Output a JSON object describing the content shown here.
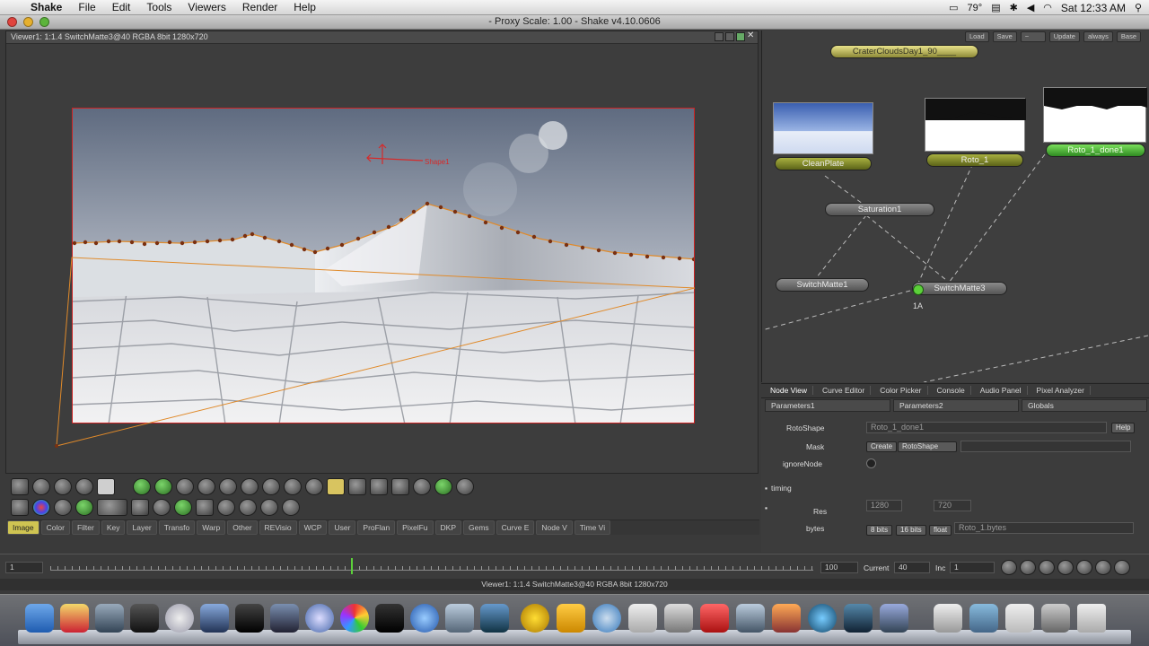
{
  "menubar": {
    "app_name": "Shake",
    "items": [
      "File",
      "Edit",
      "Tools",
      "Viewers",
      "Render",
      "Help"
    ],
    "status": {
      "temp": "79°",
      "clock": "Sat 12:33 AM"
    }
  },
  "window": {
    "title": "- Proxy Scale: 1.00 - Shake v4.10.0606"
  },
  "viewer": {
    "header": "Viewer1: 1:1.4 SwitchMatte3@40 RGBA 8bit 1280x720",
    "shape_label": "Shape1"
  },
  "tool_tabs": [
    "Image",
    "Color",
    "Filter",
    "Key",
    "Layer",
    "Transfo",
    "Warp",
    "Other",
    "REVisio",
    "WCP",
    "User",
    "ProFlan",
    "PixelFu",
    "DKP",
    "Gems",
    "Curve E",
    "Node V",
    "Time Vi"
  ],
  "active_tool_tab": "Image",
  "timeline": {
    "start": "1",
    "end": "100",
    "current_label": "Current",
    "current_value": "40",
    "inc_label": "Inc",
    "inc_value": "1",
    "marker_frame": 40
  },
  "status_line": "Viewer1: 1:1.4 SwitchMatte3@40 RGBA 8bit 1280x720",
  "node_toolbar": [
    "Load",
    "Save",
    "Update",
    "always",
    "Base"
  ],
  "nodes": {
    "file_in": "CraterCloudsDay1_90____",
    "clean_plate": "CleanPlate",
    "roto1": "Roto_1",
    "roto_done": "Roto_1_done1",
    "saturation": "Saturation1",
    "switchmatte1": "SwitchMatte1",
    "switchmatte3": "SwitchMatte3",
    "label_1a": "1A"
  },
  "panel_tabs": [
    "Node View",
    "Curve Editor",
    "Color Picker",
    "Console",
    "Audio Panel",
    "Pixel Analyzer"
  ],
  "params": {
    "tab1": "Parameters1",
    "tab2": "Parameters2",
    "tab3": "Globals",
    "rotoshape_label": "RotoShape",
    "rotoshape_value": "Roto_1_done1",
    "help_button": "Help",
    "mask_label": "Mask",
    "create_button": "Create",
    "mask_value": "RotoShape",
    "ignore_label": "ignoreNode",
    "timing_label": "timing",
    "res_label": "Res",
    "res_w": "1280",
    "res_h": "720",
    "bytes_label": "bytes",
    "bytes_8": "8 bits",
    "bytes_16": "16 bits",
    "bytes_float": "float",
    "bytes_value": "Roto_1.bytes"
  }
}
